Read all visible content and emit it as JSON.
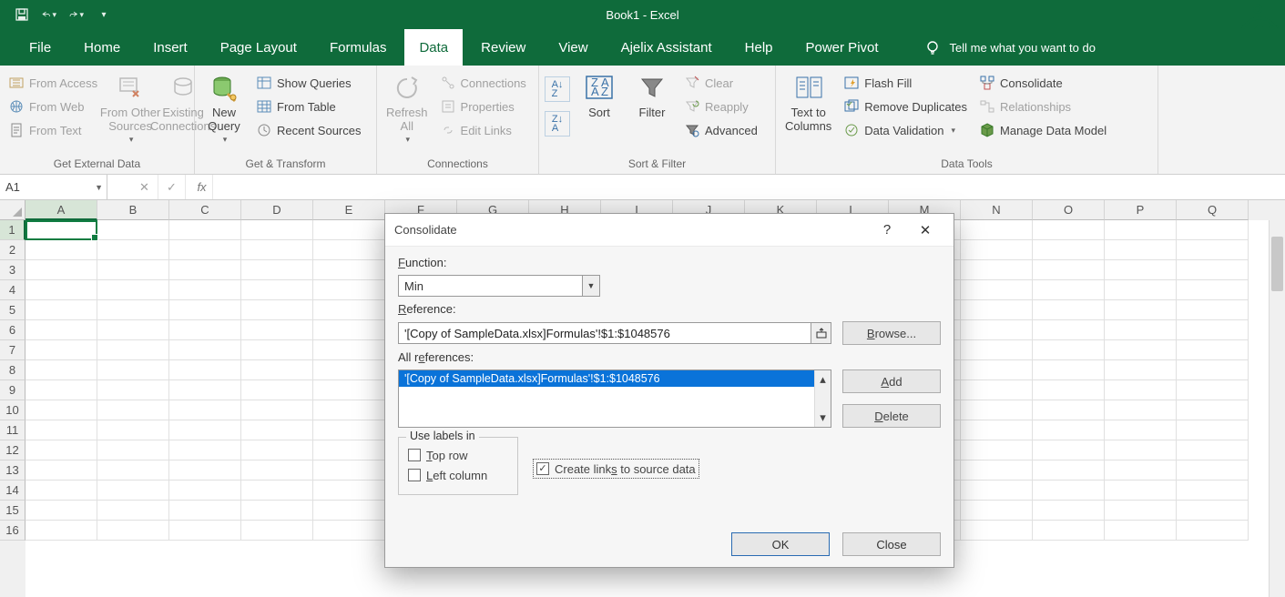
{
  "title": "Book1  -  Excel",
  "tabs": [
    "File",
    "Home",
    "Insert",
    "Page Layout",
    "Formulas",
    "Data",
    "Review",
    "View",
    "Ajelix Assistant",
    "Help",
    "Power Pivot"
  ],
  "active_tab": 5,
  "tell_me": "Tell me what you want to do",
  "ribbon": {
    "get_external": {
      "caption": "Get External Data",
      "from_access": "From Access",
      "from_web": "From Web",
      "from_text": "From Text",
      "other": "From Other\nSources",
      "existing": "Existing\nConnections"
    },
    "get_transform": {
      "caption": "Get & Transform",
      "new_query": "New\nQuery",
      "show_queries": "Show Queries",
      "from_table": "From Table",
      "recent_sources": "Recent Sources"
    },
    "connections": {
      "caption": "Connections",
      "refresh": "Refresh\nAll",
      "connections": "Connections",
      "properties": "Properties",
      "edit_links": "Edit Links"
    },
    "sort_filter": {
      "caption": "Sort & Filter",
      "sort": "Sort",
      "filter": "Filter",
      "clear": "Clear",
      "reapply": "Reapply",
      "advanced": "Advanced"
    },
    "data_tools": {
      "caption": "Data Tools",
      "text_to_columns": "Text to\nColumns",
      "flash_fill": "Flash Fill",
      "remove_dup": "Remove Duplicates",
      "data_val": "Data Validation",
      "consolidate": "Consolidate",
      "relationships": "Relationships",
      "manage_model": "Manage Data Model"
    }
  },
  "namebox": "A1",
  "columns": [
    "A",
    "B",
    "C",
    "D",
    "E",
    "F",
    "G",
    "H",
    "I",
    "J",
    "K",
    "L",
    "M",
    "N",
    "O",
    "P",
    "Q"
  ],
  "rows": [
    1,
    2,
    3,
    4,
    5,
    6,
    7,
    8,
    9,
    10,
    11,
    12,
    13,
    14,
    15,
    16
  ],
  "dialog": {
    "title": "Consolidate",
    "function_label": "Function:",
    "function_value": "Min",
    "reference_label": "Reference:",
    "reference_value": "'[Copy of SampleData.xlsx]Formulas'!$1:$1048576",
    "browse": "Browse...",
    "all_ref_label": "All references:",
    "all_ref_item": "'[Copy of SampleData.xlsx]Formulas'!$1:$1048576",
    "add": "Add",
    "delete": "Delete",
    "use_labels": "Use labels in",
    "top_row": "Top row",
    "left_col": "Left column",
    "create_links": "Create links to source data",
    "ok": "OK",
    "close": "Close"
  }
}
